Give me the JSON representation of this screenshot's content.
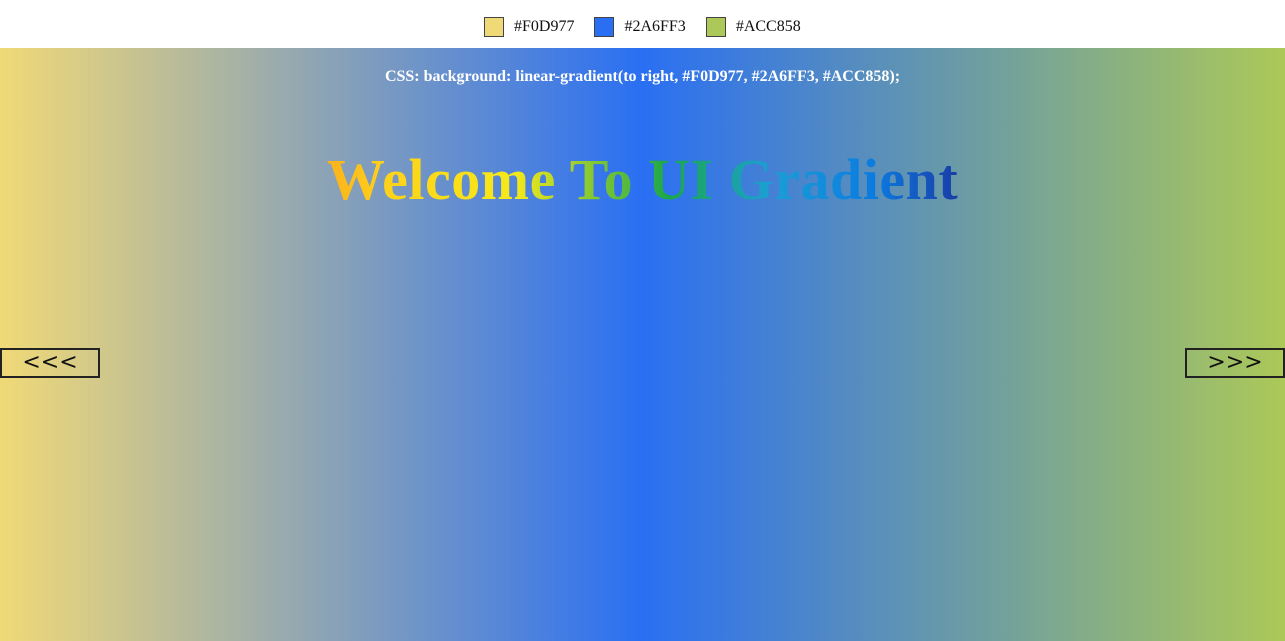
{
  "colors": {
    "stop1": "#F0D977",
    "stop2": "#2A6FF3",
    "stop3": "#ACC858"
  },
  "swatches": [
    {
      "label": "#F0D977",
      "color": "#F0D977"
    },
    {
      "label": "#2A6FF3",
      "color": "#2A6FF3"
    },
    {
      "label": "#ACC858",
      "color": "#ACC858"
    }
  ],
  "css_text": "CSS: background: linear-gradient(to right, #F0D977, #2A6FF3, #ACC858);",
  "headline": "Welcome To UI Gradient",
  "nav": {
    "prev_label": "<<<",
    "next_label": ">>>"
  }
}
